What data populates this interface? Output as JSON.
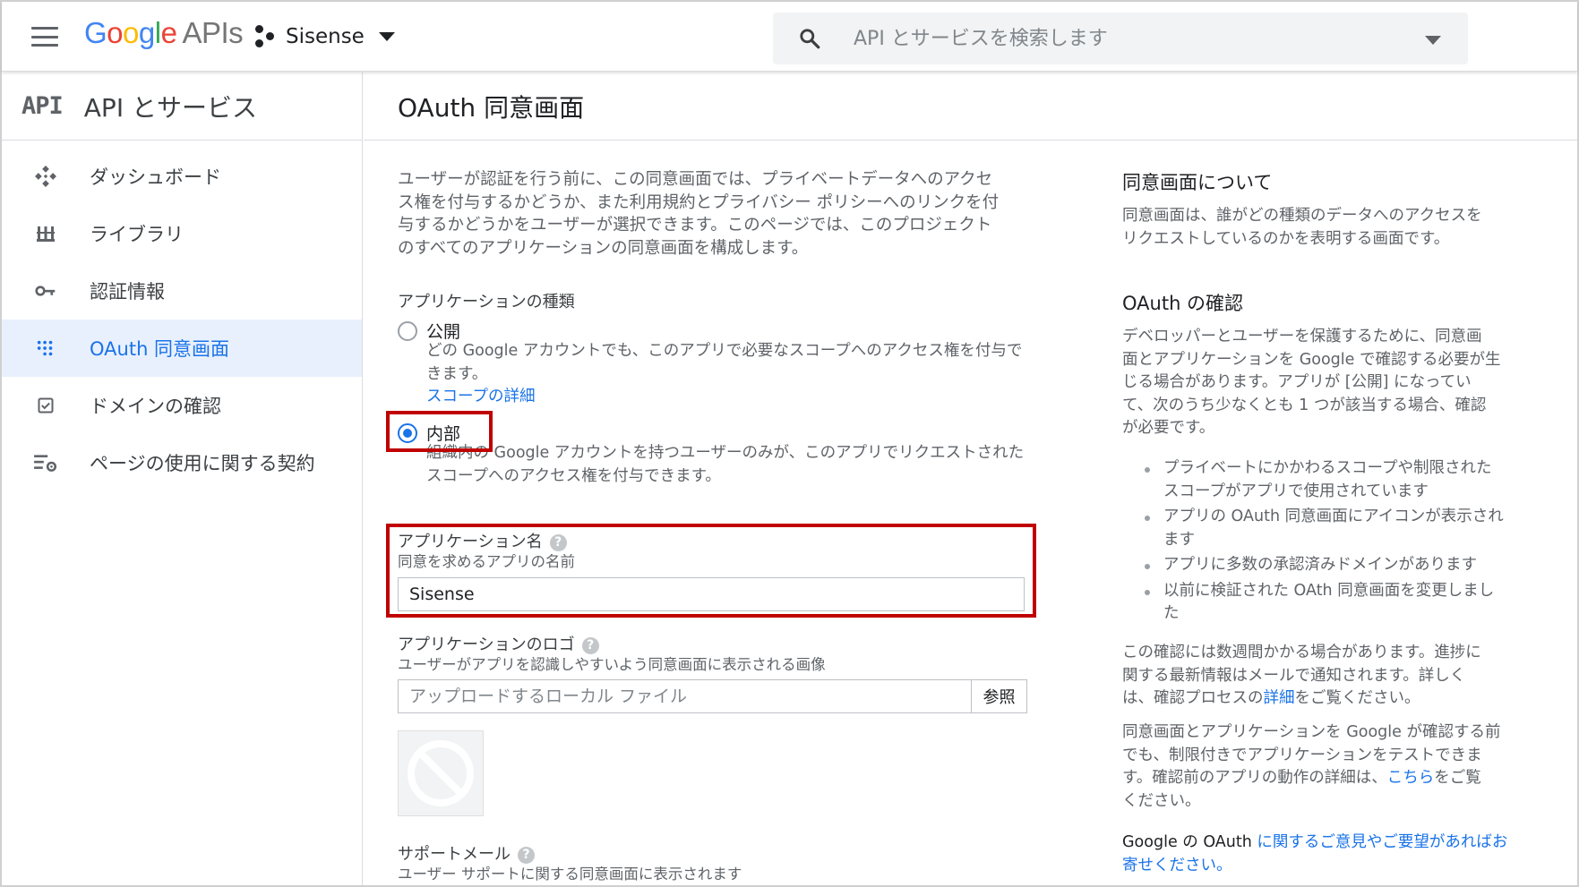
{
  "header": {
    "logo_parts": [
      "G",
      "o",
      "o",
      "g",
      "l",
      "e"
    ],
    "logo_suffix": "APIs",
    "project_name": "Sisense",
    "search_placeholder": "API とサービスを検索します"
  },
  "sidebar": {
    "badge": "API",
    "title": "API とサービス",
    "items": [
      {
        "label": "ダッシュボード",
        "icon": "dashboard-icon",
        "active": false
      },
      {
        "label": "ライブラリ",
        "icon": "library-icon",
        "active": false
      },
      {
        "label": "認証情報",
        "icon": "key-icon",
        "active": false
      },
      {
        "label": "OAuth 同意画面",
        "icon": "consent-screen-icon",
        "active": true
      },
      {
        "label": "ドメインの確認",
        "icon": "checkbox-icon",
        "active": false
      },
      {
        "label": "ページの使用に関する契約",
        "icon": "settings-list-icon",
        "active": false
      }
    ]
  },
  "page": {
    "title": "OAuth 同意画面"
  },
  "main": {
    "intro_lines": [
      "ユーザーが認証を行う前に、この同意画面では、プライベートデータへのアクセ",
      "ス権を付与するかどうか、また利用規約とプライバシー ポリシーへのリンクを付",
      "与するかどうかをユーザーが選択できます。このページでは、このプロジェクト",
      "のすべてのアプリケーションの同意画面を構成します。"
    ],
    "app_type_label": "アプリケーションの種類",
    "public_option": {
      "label": "公開",
      "desc_lines": [
        "どの Google アカウントでも、このアプリで必要なスコープへのアクセス権を付与で",
        "きます。"
      ],
      "link": "スコープの詳細",
      "selected": false
    },
    "internal_option": {
      "label": "内部",
      "desc_lines": [
        "組織内の Google アカウントを持つユーザーのみが、このアプリでリクエストされた",
        "スコープへのアクセス権を付与できます。"
      ],
      "selected": true
    },
    "app_name": {
      "label": "アプリケーション名",
      "sublabel": "同意を求めるアプリの名前",
      "value": "Sisense"
    },
    "app_logo": {
      "label": "アプリケーションのロゴ",
      "sublabel": "ユーザーがアプリを認識しやすいよう同意画面に表示される画像",
      "placeholder": "アップロードするローカル ファイル",
      "browse": "参照"
    },
    "support_email": {
      "label": "サポートメール",
      "sublabel": "ユーザー サポートに関する同意画面に表示されます"
    },
    "help_glyph": "?"
  },
  "aside": {
    "about_title": "同意画面について",
    "about_lines": [
      "同意画面は、誰がどの種類のデータへのアクセスを",
      "リクエストしているのかを表明する画面です。"
    ],
    "verify_title": "OAuth の確認",
    "verify_lines": [
      "デベロッパーとユーザーを保護するために、同意画",
      "面とアプリケーションを Google で確認する必要が生",
      "じる場合があります。アプリが [公開] になってい",
      "て、次のうち少なくとも 1 つが該当する場合、確認",
      "が必要です。"
    ],
    "bullets": [
      [
        "プライベートにかかわるスコープや制限された",
        "スコープがアプリで使用されています"
      ],
      [
        "アプリの OAuth 同意画面にアイコンが表示され",
        "ます"
      ],
      [
        "アプリに多数の承認済みドメインがあります"
      ],
      [
        "以前に検証された OAth 同意画面を変更しまし",
        "た"
      ]
    ],
    "weeks_lines": [
      "この確認には数週間かかる場合があります。進捗に",
      "関する最新情報はメールで通知されます。詳しく"
    ],
    "weeks_line3_prefix": "は、確認プロセスの",
    "weeks_link": "詳細",
    "weeks_line3_suffix": "をご覧ください。",
    "test_lines": [
      "同意画面とアプリケーションを Google が確認する前",
      "でも、制限付きでアプリケーションをテストできま"
    ],
    "test_line3_prefix": "す。確認前のアプリの動作の詳細は、",
    "test_link": "こちら",
    "test_line3_suffix": "をご覧",
    "test_line4": "ください。",
    "feedback_prefix": "Google の OAuth ",
    "feedback_link_1": "に関するご意見やご要望があればお",
    "feedback_link_2": "寄せください。"
  },
  "colors": {
    "accent": "#1a73e8",
    "highlight": "#c00000",
    "active_nav_bg": "#e8f0fe"
  }
}
